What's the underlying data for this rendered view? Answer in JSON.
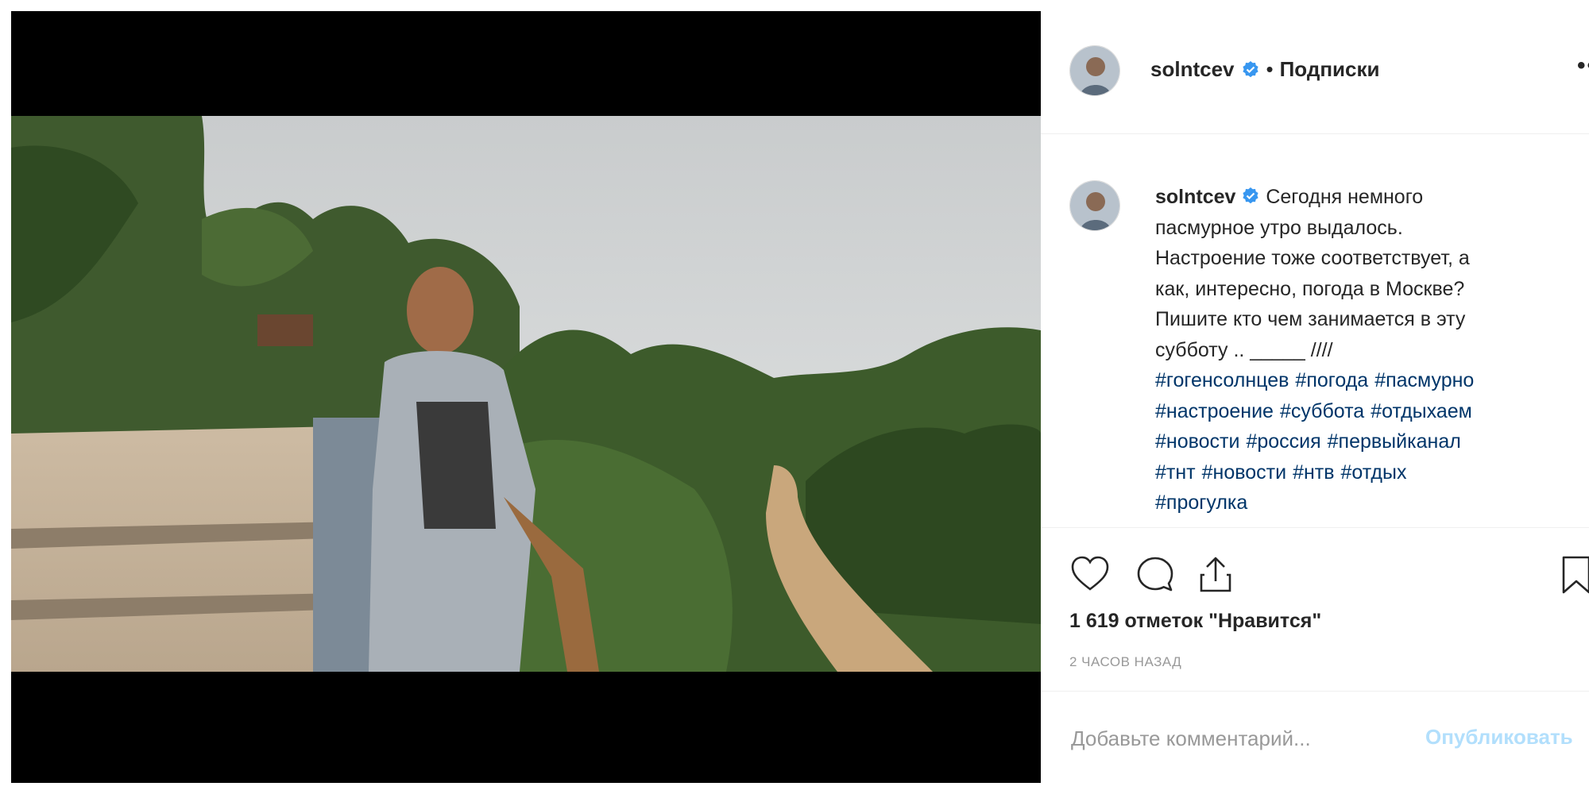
{
  "post": {
    "username": "solntcev",
    "follow_separator": "•",
    "follow_label": "Подписки",
    "more_label": "••",
    "caption_lines": [
      "Сегодня немного",
      "пасмурное утро выдалось.",
      "Настроение тоже соответствует, а",
      "как, интересно, погода в Москве?",
      "Пишите кто чем занимается в эту",
      "субботу .. _____ ////"
    ],
    "hashtag_lines": [
      [
        "#гогенсолнцев",
        "#погода",
        "#пасмурно"
      ],
      [
        "#настроение",
        "#суббота",
        "#отдыхаем"
      ],
      [
        "#новости",
        "#россия",
        "#первыйканал"
      ],
      [
        "#тнт",
        "#новости",
        "#нтв",
        "#отдых"
      ],
      [
        "#прогулка"
      ]
    ],
    "likes": "1 619 отметок \"Нравится\"",
    "time_ago": "2 ЧАСОВ НАЗАД"
  },
  "comment": {
    "placeholder": "Добавьте комментарий...",
    "publish_label": "Опубликовать"
  },
  "icons": [
    "heart-icon",
    "comment-icon",
    "share-icon",
    "bookmark-icon",
    "verified-badge-icon"
  ],
  "colors": {
    "hashtag": "#003569",
    "verified": "#3897f0",
    "publish_disabled": "#b2dffc",
    "muted": "#999999"
  }
}
